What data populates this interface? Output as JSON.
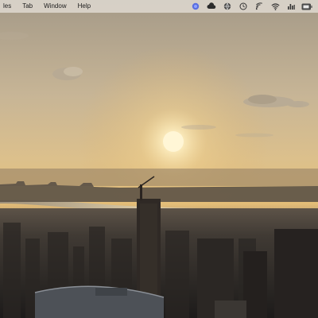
{
  "menubar": {
    "items": [
      {
        "label": "les"
      },
      {
        "label": "Tab"
      },
      {
        "label": "Window"
      },
      {
        "label": "Help"
      }
    ],
    "status_icons": [
      "colored-circle-icon",
      "cloud-sync-icon",
      "globe-icon",
      "clock-icon",
      "cast-icon",
      "wifi-icon",
      "bar-chart-icon",
      "battery-icon"
    ]
  },
  "wallpaper": {
    "subject": "city skyline at sunset",
    "colors": {
      "sky_top": "#a59a88",
      "sky_glow": "#e6c27e",
      "sun": "#fff6d6",
      "river": "#c9b69a",
      "city": "#2e2c2a"
    }
  }
}
